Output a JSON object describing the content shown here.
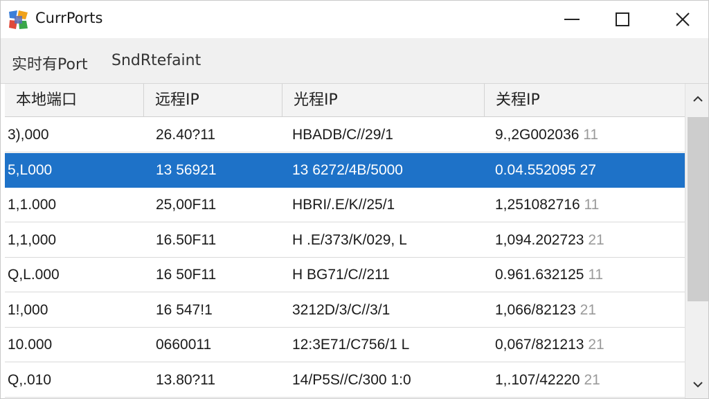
{
  "window": {
    "title": "CurrPorts",
    "controls": {
      "minimize": "minimize",
      "maximize": "maximize",
      "close": "close"
    }
  },
  "toolbar": {
    "items": [
      "实时有Port",
      "SndRtefaint"
    ]
  },
  "table": {
    "columns": [
      "本地端口",
      "远程IP",
      "光程IP",
      "关程IP"
    ],
    "selected_row": 1,
    "rows": [
      {
        "c0": "3),000",
        "c1": "26.40?11",
        "c2": "HBADB/C//29/1",
        "c3": "9.,2G002036",
        "c3_extra": "11"
      },
      {
        "c0": "5,L000",
        "c1": "13 56921",
        "c2": "13 6272/4B/5000",
        "c3": "0.04.552095",
        "c3_extra": "27"
      },
      {
        "c0": "1,1.000",
        "c1": "25,00F11",
        "c2": "HBRI/.E/K//25/1",
        "c3": "1,251082716",
        "c3_extra": "11"
      },
      {
        "c0": "1,1,000",
        "c1": "16.50F11",
        "c2": "H .E/373/K/029, L",
        "c3": "1,094.202723",
        "c3_extra": "21"
      },
      {
        "c0": "Q,L.000",
        "c1": "16 50F11",
        "c2": "H BG71/C//211",
        "c3": "0.961.632125",
        "c3_extra": "11"
      },
      {
        "c0": "1!,000",
        "c1": "16 547!1",
        "c2": "3212D/3/C//3/1",
        "c3": "1,066/82123",
        "c3_extra": "21"
      },
      {
        "c0": "10.000",
        "c1": "0660011",
        "c2": "12:3E71/C756/1 L",
        "c3": "0,067/821213",
        "c3_extra": "21"
      },
      {
        "c0": "Q,.010",
        "c1": "13.80?11",
        "c2": "14/P5S//C/300 1:0",
        "c3": "1,.107/42220",
        "c3_extra": "21"
      }
    ]
  },
  "colors": {
    "selection": "#1e72c8",
    "header_bg": "#f3f3f3",
    "toolbar_bg": "#f0f0f0"
  }
}
